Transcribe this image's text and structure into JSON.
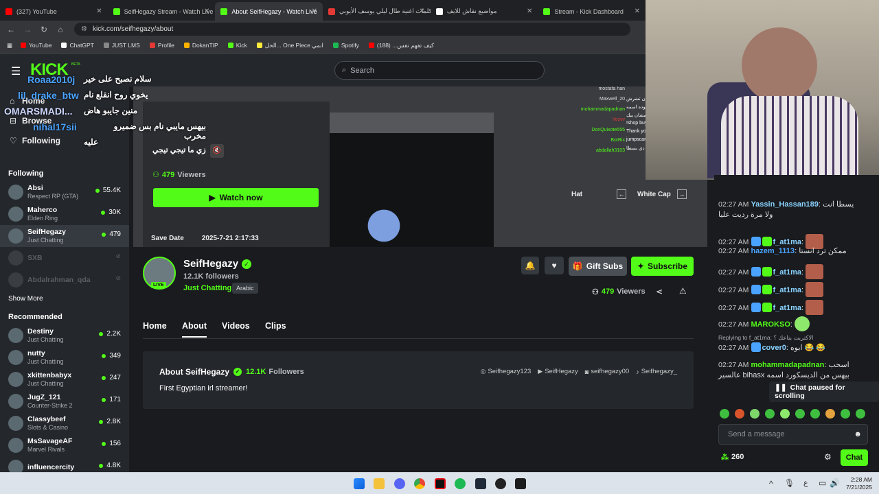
{
  "browser": {
    "tabs": [
      {
        "title": "(327) YouTube",
        "color": "#ff0000"
      },
      {
        "title": "SeifHegazy Stream - Watch Live",
        "color": "#53fc18"
      },
      {
        "title": "About SeifHegazy - Watch Live",
        "color": "#53fc18",
        "active": true
      },
      {
        "title": "كلمات اغنية طال ليلي يوسف الأيوبي",
        "color": "#e53935"
      },
      {
        "title": "مواضيع نقاش للايف",
        "color": "#ffffff"
      },
      {
        "title": "Stream - Kick Dashboard",
        "color": "#53fc18"
      }
    ],
    "url": "kick.com/seifhegazy/about",
    "bookmarks": [
      "YouTube",
      "ChatGPT",
      "JUST LMS",
      "Profile",
      "DokanTIP",
      "Kick",
      "الحل... One Piece انمي",
      "Spotify",
      "كيف تفهم نفس... (188)"
    ]
  },
  "header": {
    "logo": "KICK",
    "logo_sup": "BETA",
    "search_placeholder": "Search"
  },
  "nav": {
    "home": "Home",
    "browse": "Browse",
    "following": "Following"
  },
  "sidebar": {
    "following_title": "Following",
    "following": [
      {
        "name": "Absi",
        "game": "Respect RP (GTA)",
        "viewers": "55.4K"
      },
      {
        "name": "Maherco",
        "game": "Elden Ring",
        "viewers": "30K"
      },
      {
        "name": "SeifHegazy",
        "game": "Just Chatting",
        "viewers": "479"
      },
      {
        "name": "SXB",
        "game": "",
        "viewers": ""
      },
      {
        "name": "Abdalrahman_qda",
        "game": "",
        "viewers": ""
      }
    ],
    "show_more": "Show More",
    "recommended_title": "Recommended",
    "recommended": [
      {
        "name": "Destiny",
        "game": "Just Chatting",
        "viewers": "2.2K"
      },
      {
        "name": "nutty",
        "game": "Just Chatting",
        "viewers": "349"
      },
      {
        "name": "xkittenbabyx",
        "game": "Just Chatting",
        "viewers": "247"
      },
      {
        "name": "JugZ_121",
        "game": "Counter-Strike 2",
        "viewers": "171"
      },
      {
        "name": "Classybeef",
        "game": "Slots & Casino",
        "viewers": "2.8K"
      },
      {
        "name": "MsSavageAF",
        "game": "Marvel Rivals",
        "viewers": "156"
      },
      {
        "name": "influencercity",
        "game": "",
        "viewers": "4.8K"
      }
    ]
  },
  "overlay_chat": [
    {
      "user": "Roaa2010j",
      "text": "سلام تصبح على خير"
    },
    {
      "user": "lil_drake_btw",
      "text": "يخوي روح انقلع نام"
    },
    {
      "user": "OMARSMADI...",
      "text": "منين جايبو هاض"
    },
    {
      "user": "nihal17sii",
      "text": "بيهس مايبي نام بس ضميرو مخرب"
    },
    {
      "user": "",
      "text": "عليه"
    }
  ],
  "preview": {
    "title": "زي ما تيجي تيجي",
    "viewers": "479",
    "viewers_label": "Viewers",
    "watch_now": "Watch now",
    "save_date_label": "Save Date",
    "save_date_value": "2025-7-21 2:17:33",
    "hat_label": "Hat",
    "hat_value": "White Cap",
    "side_chat": [
      {
        "u": "mostafa han",
        "c": "#ddd"
      },
      {
        "u": "Maxwell_20",
        "c": "#ddd"
      },
      {
        "u": "mohammadapadnan",
        "c": "#53fc18"
      },
      {
        "u": "Yocvv",
        "c": "#e53935"
      },
      {
        "u": "DonQuixote555",
        "c": "#53fc18"
      },
      {
        "u": "BotRix",
        "c": "#53fc18"
      },
      {
        "u": "abdallah3103",
        "c": "#53fc18"
      }
    ],
    "side_chat_text": [
      "",
      "انت عشان تشرش",
      "المسوده اسمه",
      "الملبس مشان يبك",
      "!shop buy ju",
      "Thank you fo",
      "jumpscare @",
      "اللعبة دي بسطا"
    ]
  },
  "channel": {
    "name": "SeifHegazy",
    "followers": "12.1K followers",
    "category": "Just Chatting",
    "language": "Arabic",
    "live": "LIVE",
    "viewers": "479",
    "viewers_label": "Viewers",
    "gift_subs": "Gift Subs",
    "subscribe": "Subscribe",
    "tabs": [
      "Home",
      "About",
      "Videos",
      "Clips"
    ],
    "about_title": "About SeifHegazy",
    "about_followers": "12.1K",
    "about_followers_label": "Followers",
    "bio": "First Egyptian irl streamer!",
    "socials": [
      "Seifhegazy123",
      "SeifHegazy",
      "seifhegazy00",
      "Seifhegazy_"
    ]
  },
  "chat": {
    "messages": [
      {
        "time": "02:27 AM",
        "user": "Yassin_Hassan189",
        "color": "#8ad3ff",
        "text": "يسطا انت",
        "text2": "ولا مرة رديت عليا"
      },
      {
        "time": "02:27 AM",
        "user": "f_at1ma",
        "color": "#8ad3ff",
        "text": ""
      },
      {
        "time": "02:27 AM",
        "user": "hazem_1113",
        "color": "#4aa3ff",
        "text": "ممكن ترد انستا"
      },
      {
        "time": "02:27 AM",
        "user": "f_at1ma",
        "color": "#8ad3ff",
        "text": ""
      },
      {
        "time": "02:27 AM",
        "user": "f_at1ma",
        "color": "#8ad3ff",
        "text": ""
      },
      {
        "time": "02:27 AM",
        "user": "f_at1ma",
        "color": "#8ad3ff",
        "text": ""
      },
      {
        "time": "02:27 AM",
        "user": "MAROKSO",
        "color": "#53fc18",
        "text": ""
      },
      {
        "time": "02:27 AM",
        "user": "cover0",
        "color": "#8ad3ff",
        "text": "ابوه 😂 😂"
      },
      {
        "time": "02:27 AM",
        "user": "mohammadapadnan",
        "color": "#53fc18",
        "text": "اسحب",
        "text2": "عالسير bihasx بيهس من الديسكورد اسمه"
      }
    ],
    "reply": "Replying to f_at1ma: الاكتريت يتاعك ؟",
    "paused": "Chat paused for scrolling",
    "placeholder": "Send a message",
    "points": "260",
    "chat_button": "Chat"
  },
  "clock": {
    "time": "2:28 AM",
    "date": "7/21/2025"
  }
}
